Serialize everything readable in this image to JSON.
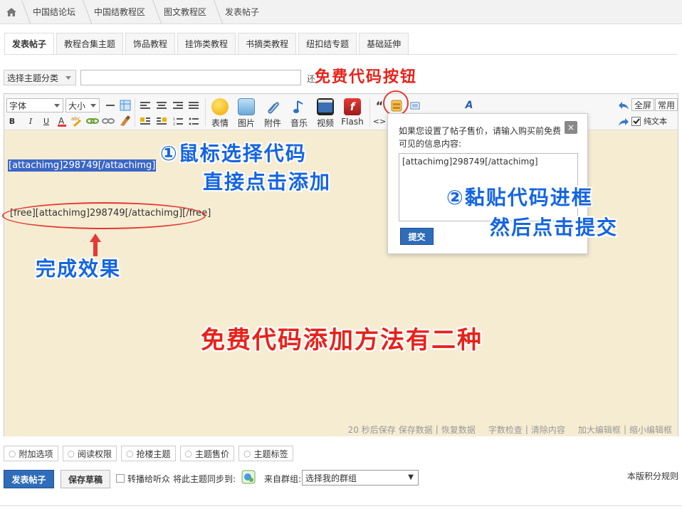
{
  "breadcrumb": [
    "中国结论坛",
    "中国结教程区",
    "图文教程区",
    "发表帖子"
  ],
  "tabs": [
    "发表帖子",
    "教程合集主题",
    "饰品教程",
    "挂饰类教程",
    "书摘类教程",
    "纽扣结专题",
    "基础延伸"
  ],
  "subject": {
    "type_select": "选择主题分类",
    "remaining": "还"
  },
  "toolbar": {
    "font": "字体",
    "size": "大小",
    "bold": "B",
    "italic": "I",
    "underline": "U",
    "emoji": "表情",
    "image": "图片",
    "attach": "附件",
    "music": "音乐",
    "video": "视频",
    "flash": "Flash",
    "quote": "“",
    "code": "<>",
    "fullscreen": "全屏",
    "common": "常用",
    "plaintext": "纯文本"
  },
  "editor": {
    "selected_text": "[attachimg]298749[/attachimg]",
    "result_text": "[free][attachimg]298749[/attachimg][/free]"
  },
  "statusbar": [
    "20 秒后保存",
    "保存数据",
    "恢复数据",
    "字数检查",
    "清除内容",
    "加大编辑框",
    "缩小编辑框"
  ],
  "popup": {
    "text": "如果您设置了帖子售价，请输入购买前免费可见的信息内容:",
    "textarea_value": "[attachimg]298749[/attachimg]",
    "submit": "提交",
    "close": "×"
  },
  "annotations": {
    "free_button": "免费代码按钮",
    "step1_line1": "①鼠标选择代码",
    "step1_line2": "直接点击添加",
    "step2_line1": "②黏贴代码进框",
    "step2_line2": "然后点击提交",
    "result": "完成效果",
    "main": "免费代码添加方法有二种"
  },
  "extra_tabs": [
    "附加选项",
    "阅读权限",
    "抢楼主题",
    "主题售价",
    "主题标签"
  ],
  "bottom": {
    "post": "发表帖子",
    "draft": "保存草稿",
    "forward": "转播给听众",
    "sync": "将此主题同步到:",
    "group_label": "来自群组:",
    "group_select": "选择我的群组",
    "rules": "本版积分规则"
  },
  "colors": {
    "accent": "#2f6db9",
    "editor_bg": "#f6ecd2",
    "annotation_red": "#e8221a",
    "annotation_blue": "#1565e0"
  }
}
